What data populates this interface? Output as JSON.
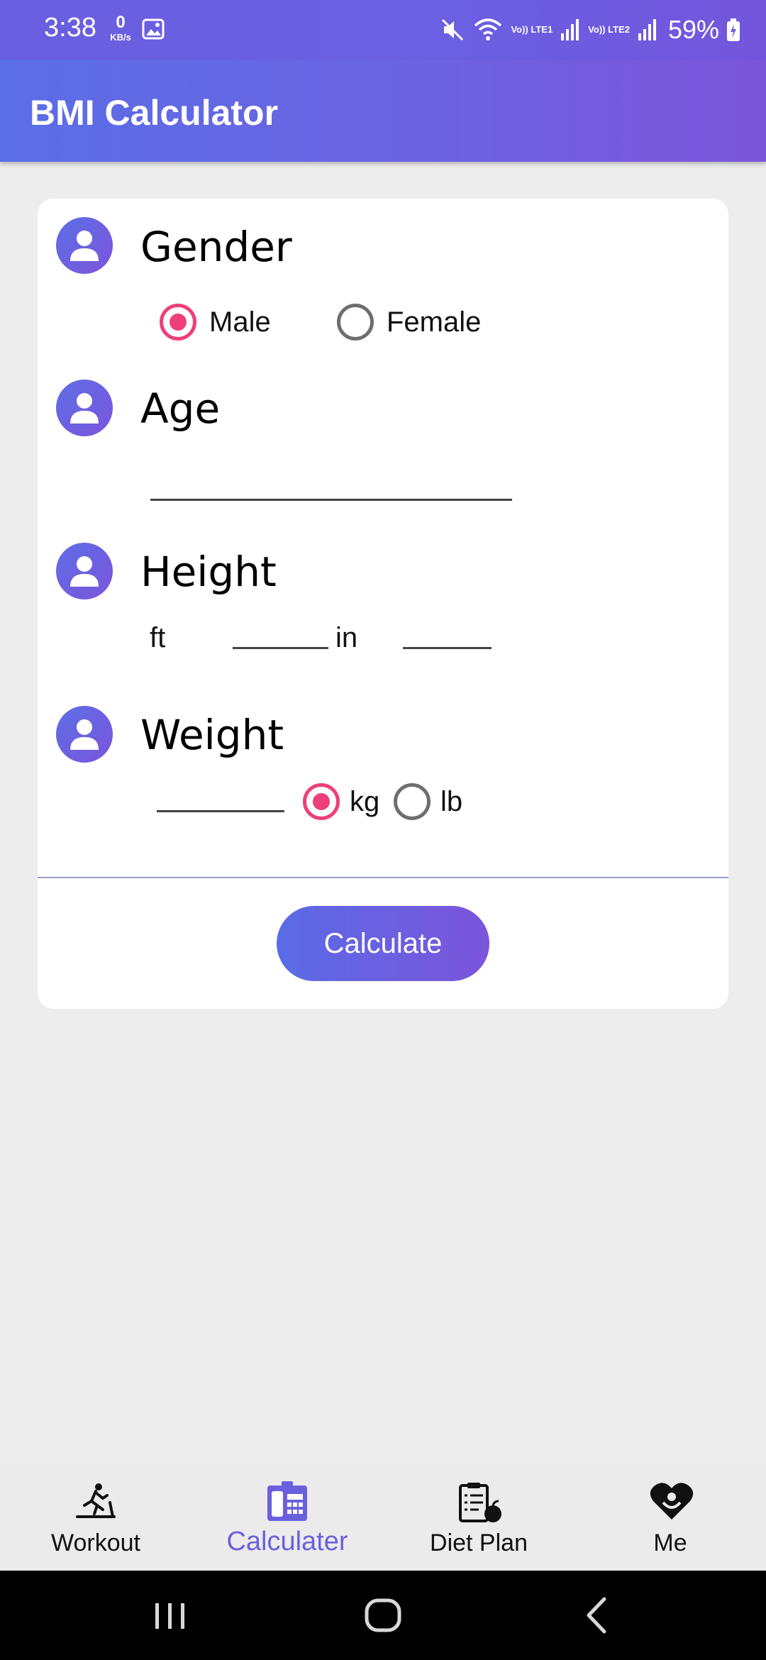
{
  "status_bar": {
    "time": "3:38",
    "net_speed_value": "0",
    "net_speed_unit": "KB/s",
    "sim1": "Vo)) LTE1",
    "sim2": "Vo)) LTE2",
    "battery": "59%"
  },
  "app_bar": {
    "title": "BMI Calculator"
  },
  "form": {
    "gender": {
      "title": "Gender",
      "options": [
        {
          "label": "Male",
          "selected": true
        },
        {
          "label": "Female",
          "selected": false
        }
      ]
    },
    "age": {
      "title": "Age",
      "value": ""
    },
    "height": {
      "title": "Height",
      "ft_label": "ft",
      "in_label": "in",
      "ft_value": "",
      "in_value": ""
    },
    "weight": {
      "title": "Weight",
      "value": "",
      "units": [
        {
          "label": "kg",
          "selected": true
        },
        {
          "label": "lb",
          "selected": false
        }
      ]
    },
    "calculate_label": "Calculate"
  },
  "bottom_nav": {
    "items": [
      {
        "label": "Workout",
        "icon": "treadmill-icon",
        "active": false
      },
      {
        "label": "Calculater",
        "icon": "calculator-icon",
        "active": true
      },
      {
        "label": "Diet Plan",
        "icon": "diet-clipboard-icon",
        "active": false
      },
      {
        "label": "Me",
        "icon": "heart-person-icon",
        "active": false
      }
    ]
  },
  "colors": {
    "accent_start": "#5b6ee6",
    "accent_end": "#7b56da",
    "radio_selected": "#ee3f7a",
    "active_tab": "#6a60dd"
  }
}
